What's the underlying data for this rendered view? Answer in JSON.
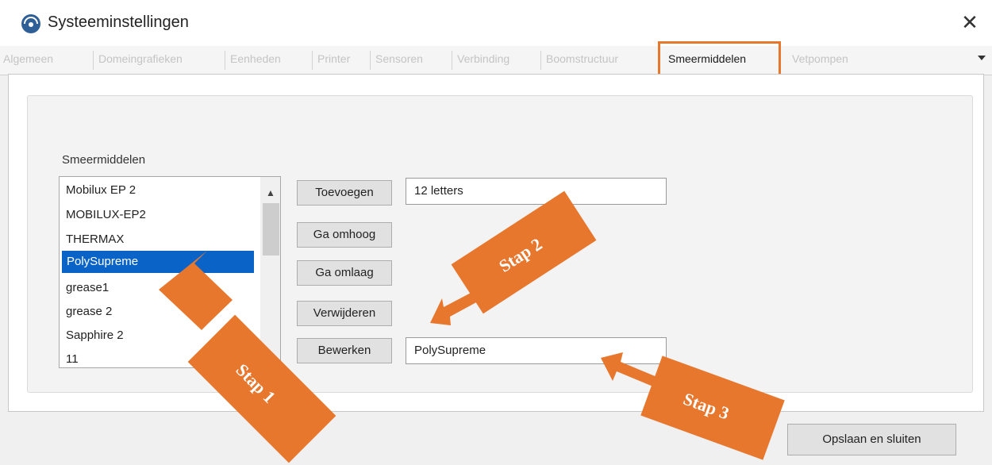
{
  "window": {
    "title": "Systeeminstellingen",
    "close_label": "✕",
    "icon": "app-logo-icon"
  },
  "tabs": [
    {
      "label": "Algemeen",
      "active": false
    },
    {
      "label": "Domeingrafieken",
      "active": false
    },
    {
      "label": "Eenheden",
      "active": false
    },
    {
      "label": "Printer",
      "active": false
    },
    {
      "label": "Sensoren",
      "active": false
    },
    {
      "label": "Verbinding",
      "active": false
    },
    {
      "label": "Boomstructuur",
      "active": false
    },
    {
      "label": "Smeermiddelen",
      "active": true
    },
    {
      "label": "Vetpompen",
      "active": false
    }
  ],
  "group": {
    "label": "Smeermiddelen"
  },
  "list": {
    "items": [
      "Mobilux EP 2",
      "MOBILUX-EP2",
      "THERMAX",
      "PolySupreme",
      "grease1",
      "grease 2",
      "Sapphire 2",
      "11"
    ],
    "selected": "PolySupreme"
  },
  "buttons": {
    "add": "Toevoegen",
    "up": "Ga omhoog",
    "down": "Ga omlaag",
    "remove": "Verwijderen",
    "edit": "Bewerken",
    "save_close": "Opslaan en sluiten"
  },
  "fields": {
    "add_value": "12 letters",
    "edit_value": "PolySupreme"
  },
  "annotations": {
    "step1": "Stap 1",
    "step2": "Stap 2",
    "step3": "Stap 3",
    "color": "#e8772e"
  },
  "colors": {
    "selection": "#0a64c8",
    "highlight": "#e8772e"
  }
}
